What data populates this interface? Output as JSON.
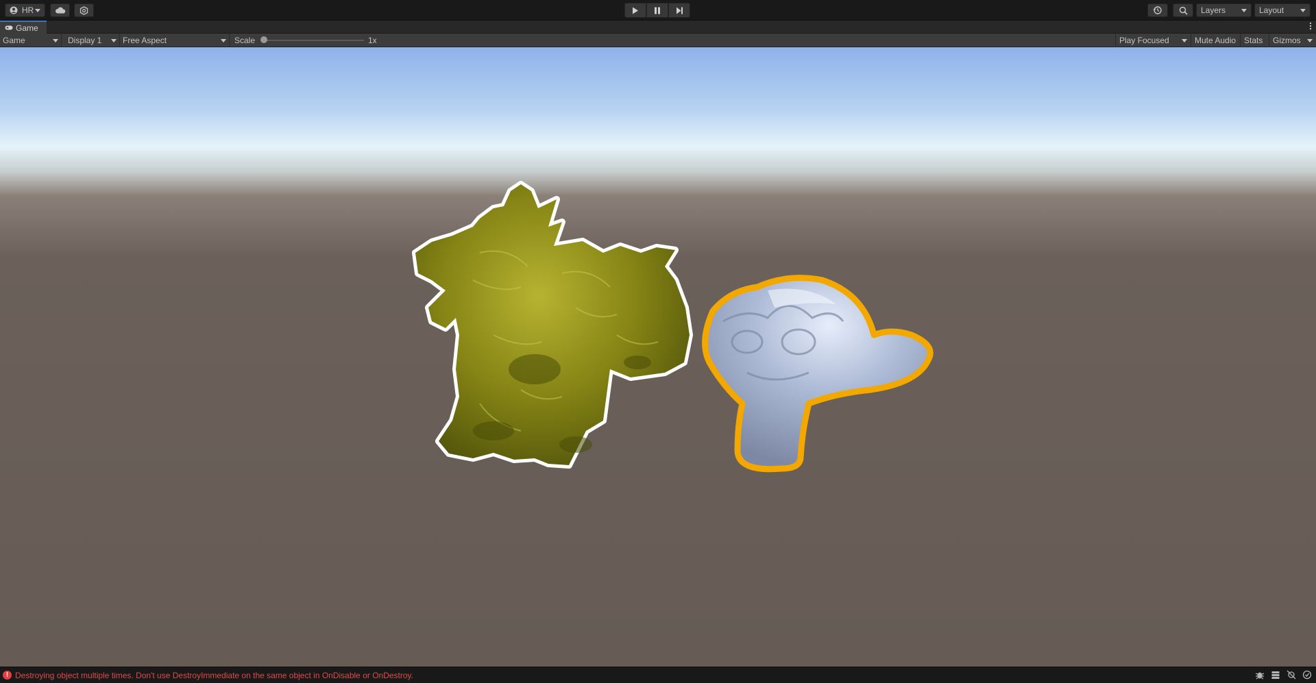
{
  "toolbar": {
    "account_label": "HR",
    "layers_label": "Layers",
    "layout_label": "Layout"
  },
  "tab": {
    "title": "Game"
  },
  "game_toolbar": {
    "mode": "Game",
    "display": "Display 1",
    "aspect": "Free Aspect",
    "scale_label": "Scale",
    "scale_value": "1x",
    "scale_fraction": 0.0,
    "play_mode": "Play Focused",
    "mute_label": "Mute Audio",
    "stats_label": "Stats",
    "gizmos_label": "Gizmos"
  },
  "scene": {
    "dragon_color": "#8a8a1a",
    "dragon_outline": "#ffffff",
    "monkey_color": "#a9b5cf",
    "monkey_outline": "#f2a800"
  },
  "status": {
    "error_icon": "!",
    "message": "Destroying object multiple times. Don't use DestroyImmediate on the same object in OnDisable or OnDestroy."
  }
}
